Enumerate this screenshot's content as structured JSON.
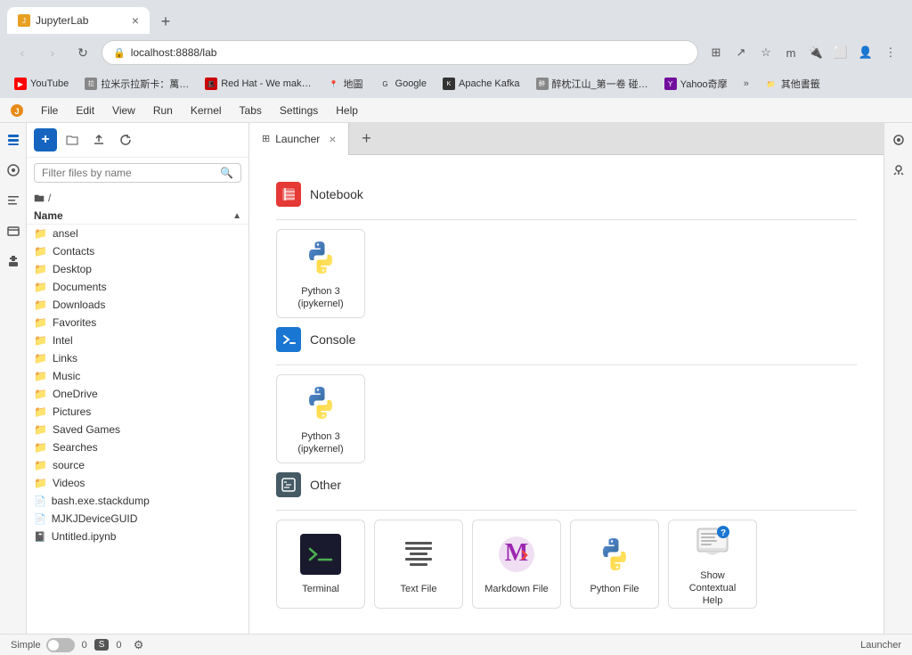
{
  "browser": {
    "tab_title": "JupyterLab",
    "address": "localhost:8888/lab",
    "new_tab_label": "+",
    "bookmarks": [
      {
        "id": "youtube",
        "label": "YouTube",
        "color": "#ff0000"
      },
      {
        "id": "ramen",
        "label": "拉米示拉斯卡：萬…",
        "color": "#888"
      },
      {
        "id": "redhat",
        "label": "Red Hat - We mak…",
        "color": "#cc0000"
      },
      {
        "id": "maps",
        "label": "地圖",
        "color": "#4caf50"
      },
      {
        "id": "google",
        "label": "Google",
        "color": "#4285f4"
      },
      {
        "id": "kafka",
        "label": "Apache Kafka",
        "color": "#333"
      },
      {
        "id": "yomue",
        "label": "醉枕江山_第一卷 碰…",
        "color": "#888"
      },
      {
        "id": "yahoo",
        "label": "Yahoo奇摩",
        "color": "#720e9e"
      }
    ],
    "more_bookmarks": "»",
    "bookmarks_folder": "其他書籤"
  },
  "app": {
    "menu_items": [
      "File",
      "Edit",
      "View",
      "Run",
      "Kernel",
      "Tabs",
      "Settings",
      "Help"
    ],
    "file_browser": {
      "new_btn": "+",
      "search_placeholder": "Filter files by name",
      "path": "/",
      "name_header": "Name",
      "files": [
        {
          "type": "folder",
          "name": "ansel"
        },
        {
          "type": "folder",
          "name": "Contacts"
        },
        {
          "type": "folder",
          "name": "Desktop"
        },
        {
          "type": "folder",
          "name": "Documents"
        },
        {
          "type": "folder",
          "name": "Downloads"
        },
        {
          "type": "folder",
          "name": "Favorites"
        },
        {
          "type": "folder",
          "name": "Intel"
        },
        {
          "type": "folder",
          "name": "Links"
        },
        {
          "type": "folder",
          "name": "Music"
        },
        {
          "type": "folder",
          "name": "OneDrive"
        },
        {
          "type": "folder",
          "name": "Pictures"
        },
        {
          "type": "folder",
          "name": "Saved Games"
        },
        {
          "type": "folder",
          "name": "Searches"
        },
        {
          "type": "folder",
          "name": "source"
        },
        {
          "type": "folder",
          "name": "Videos"
        },
        {
          "type": "file",
          "name": "bash.exe.stackdump"
        },
        {
          "type": "file",
          "name": "MJKJDeviceGUID"
        },
        {
          "type": "notebook",
          "name": "Untitled.ipynb"
        }
      ]
    },
    "launcher": {
      "tab_label": "Launcher",
      "sections": [
        {
          "id": "notebook",
          "title": "Notebook",
          "cards": [
            {
              "id": "python3-notebook",
              "label": "Python 3\n(ipykernel)"
            }
          ]
        },
        {
          "id": "console",
          "title": "Console",
          "cards": [
            {
              "id": "python3-console",
              "label": "Python 3\n(ipykernel)"
            }
          ]
        },
        {
          "id": "other",
          "title": "Other",
          "cards": [
            {
              "id": "terminal",
              "label": "Terminal"
            },
            {
              "id": "text-file",
              "label": "Text File"
            },
            {
              "id": "markdown-file",
              "label": "Markdown File"
            },
            {
              "id": "python-file",
              "label": "Python File"
            },
            {
              "id": "contextual-help",
              "label": "Show Contextual Help"
            }
          ]
        }
      ]
    }
  },
  "status_bar": {
    "simple_label": "Simple",
    "counter1": "0",
    "badge1": "S",
    "counter2": "0",
    "right_label": "Launcher"
  }
}
